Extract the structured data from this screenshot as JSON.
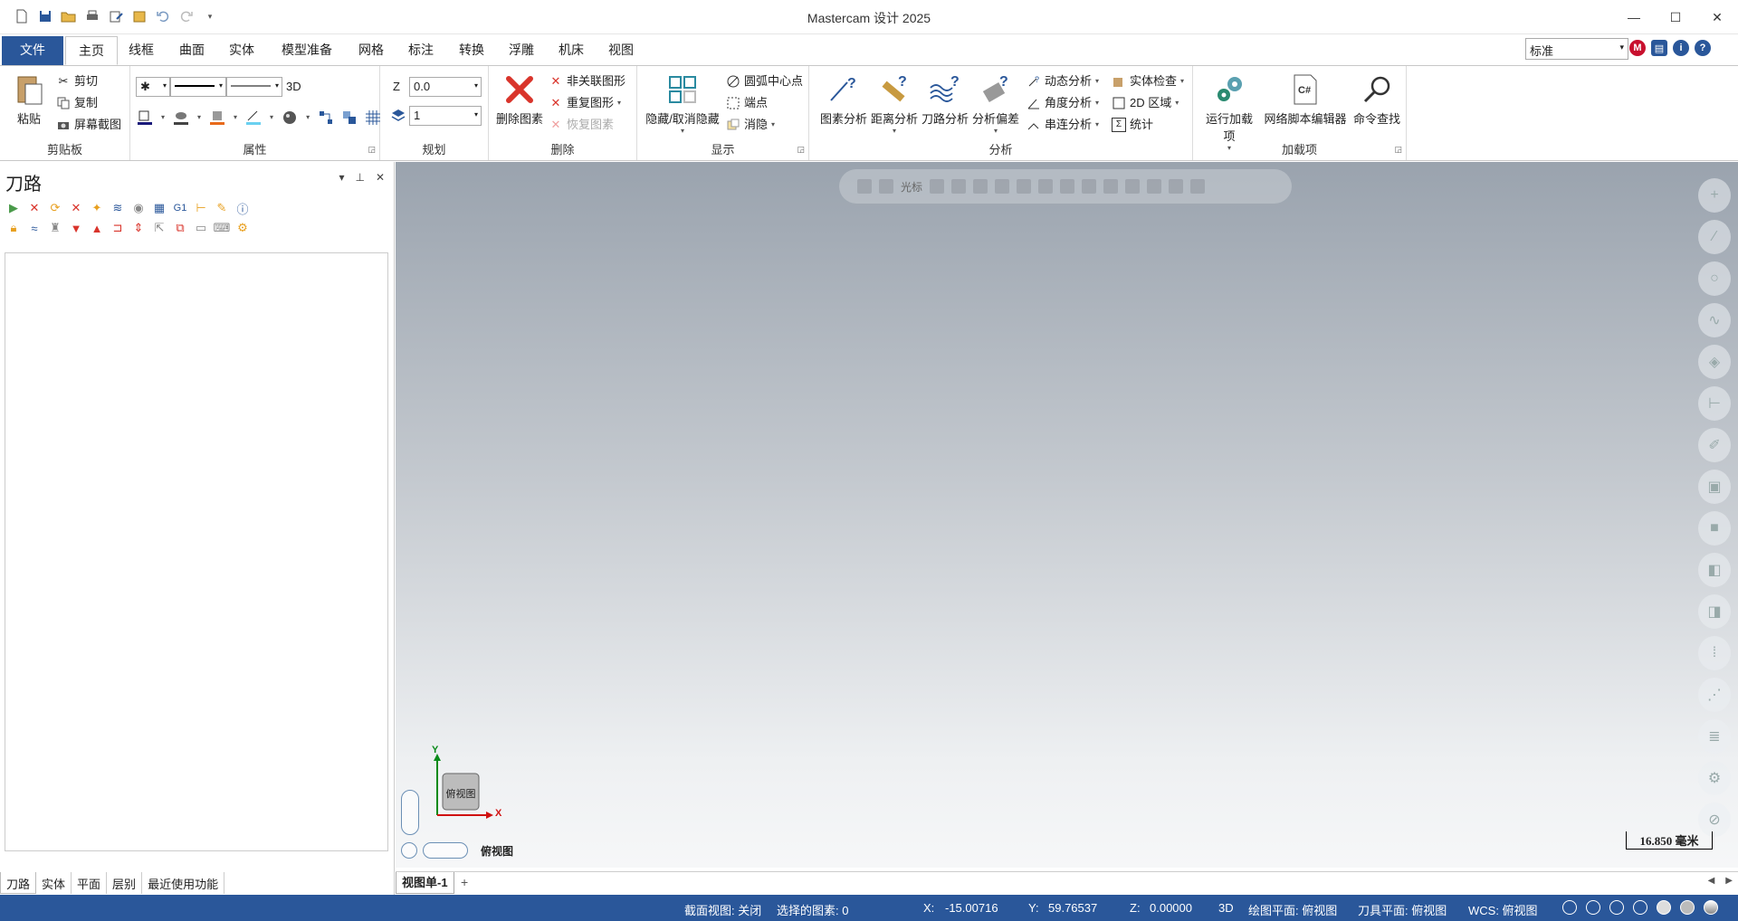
{
  "window": {
    "title": "Mastercam 设计 2025"
  },
  "qat": {
    "icons": [
      "new-file-icon",
      "save-icon",
      "open-icon",
      "print-icon",
      "edit-icon",
      "folder-icon",
      "undo-icon",
      "redo-icon",
      "customize-icon"
    ]
  },
  "tabs": [
    {
      "label": "文件"
    },
    {
      "label": "主页"
    },
    {
      "label": "线框"
    },
    {
      "label": "曲面"
    },
    {
      "label": "实体"
    },
    {
      "label": "模型准备"
    },
    {
      "label": "网格"
    },
    {
      "label": "标注"
    },
    {
      "label": "转换"
    },
    {
      "label": "浮雕"
    },
    {
      "label": "机床"
    },
    {
      "label": "视图"
    }
  ],
  "style_selector": {
    "value": "标准"
  },
  "ribbon": {
    "clipboard": {
      "label": "剪贴板",
      "paste": "粘贴",
      "cut": "剪切",
      "copy": "复制",
      "screenshot": "屏幕截图"
    },
    "attributes": {
      "label": "属性",
      "mode_3d": "3D"
    },
    "planning": {
      "label": "规划",
      "z_label": "Z",
      "z_value": "0.0",
      "level_value": "1"
    },
    "delete": {
      "label": "删除",
      "delete_entities": "删除图素",
      "unassoc": "非关联图形",
      "duplicate": "重复图形",
      "restore": "恢复图素"
    },
    "display": {
      "label": "显示",
      "hide_unhide": "隐藏/取消隐藏",
      "arc_center": "圆弧中心点",
      "endpoints": "端点",
      "blank": "消隐"
    },
    "analysis": {
      "label": "分析",
      "entity": "图素分析",
      "distance": "距离分析",
      "toolpath": "刀路分析",
      "offset": "分析偏差",
      "dynamic": "动态分析",
      "angle": "角度分析",
      "chain": "串连分析",
      "solid_check": "实体检查",
      "area2d": "2D 区域",
      "stats": "统计"
    },
    "addins": {
      "label": "加载项",
      "run": "运行加载项",
      "script_editor": "网络脚本编辑器",
      "command_finder": "命令查找"
    }
  },
  "panel": {
    "title": "刀路",
    "bottom_tabs": [
      {
        "label": "刀路"
      },
      {
        "label": "实体"
      },
      {
        "label": "平面"
      },
      {
        "label": "层别"
      },
      {
        "label": "最近使用功能"
      }
    ]
  },
  "viewport": {
    "toolbar_label": "光标",
    "view_name": "俯视图",
    "gnomon_label": "俯视图",
    "axis_x": "X",
    "axis_y": "Y",
    "scale": "16.850 毫米",
    "tab": "视图单-1",
    "add_tab": "+"
  },
  "status": {
    "section_view": "截面视图: 关闭",
    "selected": "选择的图素: 0",
    "x_label": "X:",
    "x": "-15.00716",
    "y_label": "Y:",
    "y": "59.76537",
    "z_label": "Z:",
    "z": "0.00000",
    "mode": "3D",
    "cplane": "绘图平面: 俯视图",
    "tplane": "刀具平面: 俯视图",
    "wcs": "WCS: 俯视图"
  },
  "colors": {
    "accent": "#2a579a",
    "delete_red": "#d9342b"
  }
}
